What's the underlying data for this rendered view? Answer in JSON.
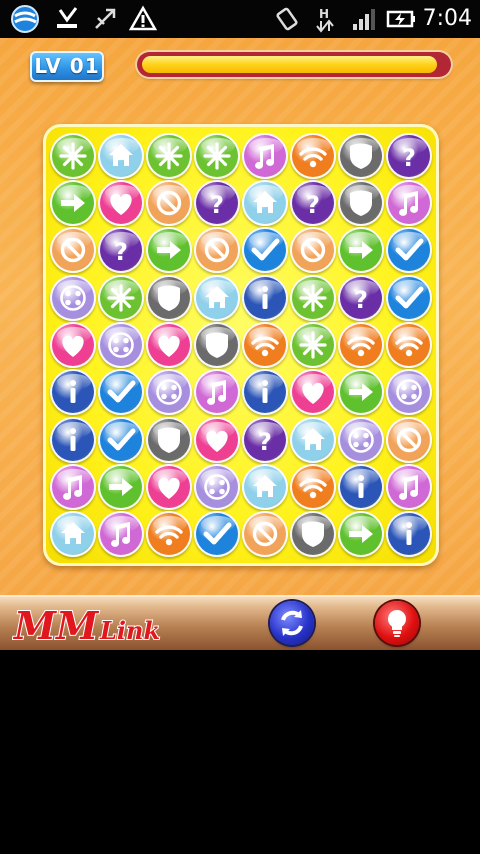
{
  "status_bar": {
    "time": "7:04",
    "icons": [
      "app-badge-icon",
      "download-done-icon",
      "usb-debug-icon",
      "warning-icon",
      "screen-rotate-icon",
      "hspa-data-icon",
      "signal-strength-icon",
      "battery-charging-icon"
    ]
  },
  "game": {
    "level_label": "LV 01",
    "timer_progress": 0.97,
    "title_logo": {
      "line1": "MM",
      "line2": "Link"
    },
    "buttons": [
      "refresh-icon",
      "hint-bulb-icon"
    ],
    "board": {
      "columns": 8,
      "rows": 9,
      "grid": [
        [
          "asterisk",
          "home",
          "asterisk",
          "asterisk",
          "music",
          "wifi",
          "shield",
          "question"
        ],
        [
          "arrow",
          "heart",
          "ban",
          "question",
          "home",
          "question",
          "shield",
          "music"
        ],
        [
          "ban",
          "question",
          "arrow",
          "ban",
          "check",
          "ban",
          "arrow",
          "check"
        ],
        [
          "film",
          "asterisk",
          "shield",
          "home",
          "info",
          "asterisk",
          "question",
          "check"
        ],
        [
          "heart",
          "film",
          "heart",
          "shield",
          "wifi",
          "asterisk",
          "wifi",
          "wifi"
        ],
        [
          "info",
          "check",
          "film",
          "music",
          "info",
          "heart",
          "arrow",
          "film"
        ],
        [
          "info",
          "check",
          "shield",
          "heart",
          "question",
          "home",
          "film",
          "ban"
        ],
        [
          "music",
          "arrow",
          "heart",
          "film",
          "home",
          "wifi",
          "info",
          "music"
        ],
        [
          "home",
          "music",
          "wifi",
          "check",
          "ban",
          "shield",
          "arrow",
          "info"
        ]
      ],
      "tile_colors": {
        "asterisk": "#6cc230",
        "home": "#8fd0ea",
        "music": "#d068d6",
        "wifi": "#f07d1e",
        "shield": "#6b6b6b",
        "question": "#6a2ea6",
        "arrow": "#5fc12d",
        "heart": "#ee3f93",
        "ban": "#f2a35a",
        "check": "#1e83dd",
        "film": "#a78fe0",
        "info": "#2b56b8"
      }
    }
  }
}
